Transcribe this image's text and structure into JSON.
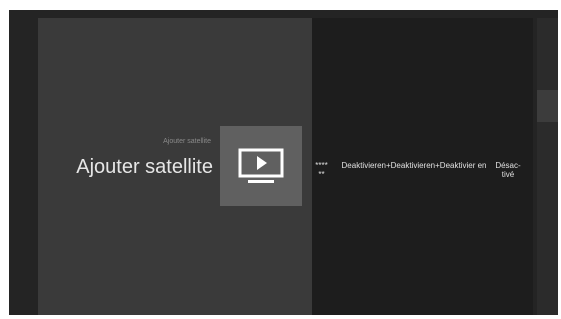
{
  "header": {
    "subtitle": "Ajouter satellite",
    "title": "Ajouter satellite"
  },
  "tile": {
    "icon": "tv-play-icon"
  },
  "row": {
    "items": [
      {
        "label": "**** **"
      },
      {
        "label": "Deaktivieren+Deaktivieren+Deaktivier en"
      },
      {
        "label": "Désac- tivé"
      }
    ]
  },
  "colors": {
    "background": "#242424",
    "panel": "#3a3a3a",
    "tile": "#606060",
    "text": "#e6e6e6",
    "muted_text": "#8a8a8a"
  }
}
